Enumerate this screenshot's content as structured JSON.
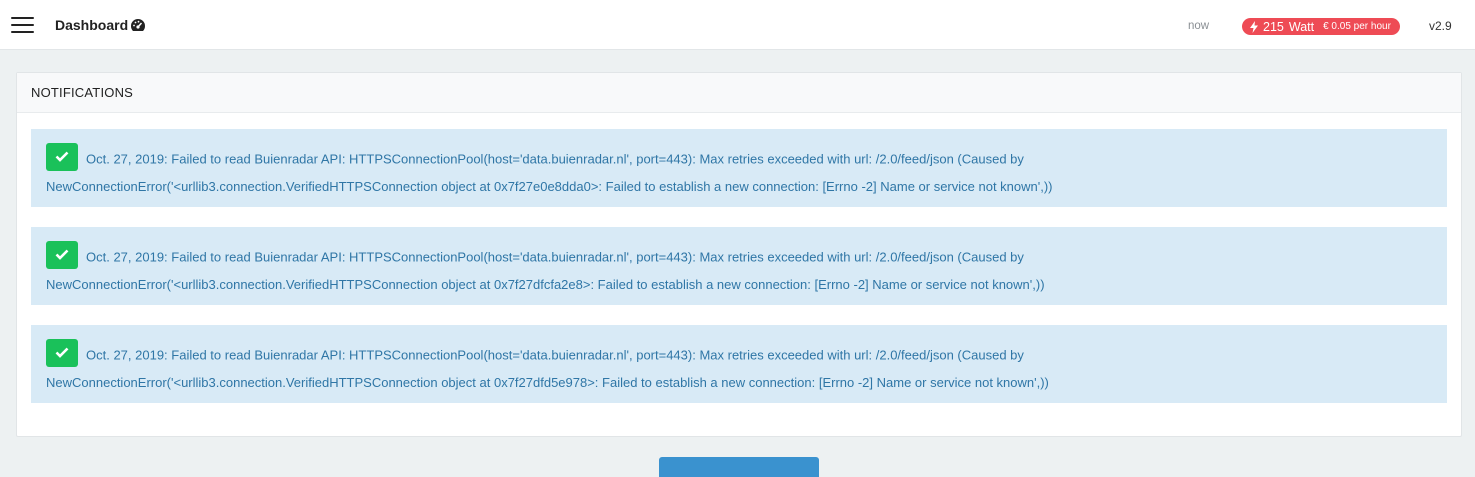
{
  "header": {
    "title": "Dashboard",
    "icons": {
      "menu": "hamburger-menu-icon",
      "title_icon": "gauge-icon",
      "power": "bolt-icon"
    },
    "timestamp": "now",
    "power": {
      "value": "215",
      "unit": "Watt",
      "cost": "€ 0.05 per hour"
    },
    "version": "v2.9",
    "colors": {
      "power_badge": "#ee4b55"
    }
  },
  "notifications": {
    "heading": "NOTIFICATIONS",
    "items": [
      {
        "line1": "Oct. 27, 2019: Failed to read Buienradar API: HTTPSConnectionPool(host='data.buienradar.nl', port=443): Max retries exceeded with url: /2.0/feed/json (Caused by",
        "line2": "NewConnectionError('<urllib3.connection.VerifiedHTTPSConnection object at 0x7f27e0e8dda0>: Failed to establish a new connection: [Errno -2] Name or service not known',))"
      },
      {
        "line1": "Oct. 27, 2019: Failed to read Buienradar API: HTTPSConnectionPool(host='data.buienradar.nl', port=443): Max retries exceeded with url: /2.0/feed/json (Caused by",
        "line2": "NewConnectionError('<urllib3.connection.VerifiedHTTPSConnection object at 0x7f27dfcfa2e8>: Failed to establish a new connection: [Errno -2] Name or service not known',))"
      },
      {
        "line1": "Oct. 27, 2019: Failed to read Buienradar API: HTTPSConnectionPool(host='data.buienradar.nl', port=443): Max retries exceeded with url: /2.0/feed/json (Caused by",
        "line2": "NewConnectionError('<urllib3.connection.VerifiedHTTPSConnection object at 0x7f27dfd5e978>: Failed to establish a new connection: [Errno -2] Name or service not known',))"
      }
    ],
    "colors": {
      "alert_bg": "#d8eaf6",
      "alert_text": "#2f76a6",
      "check_bg": "#1ac15a"
    }
  }
}
